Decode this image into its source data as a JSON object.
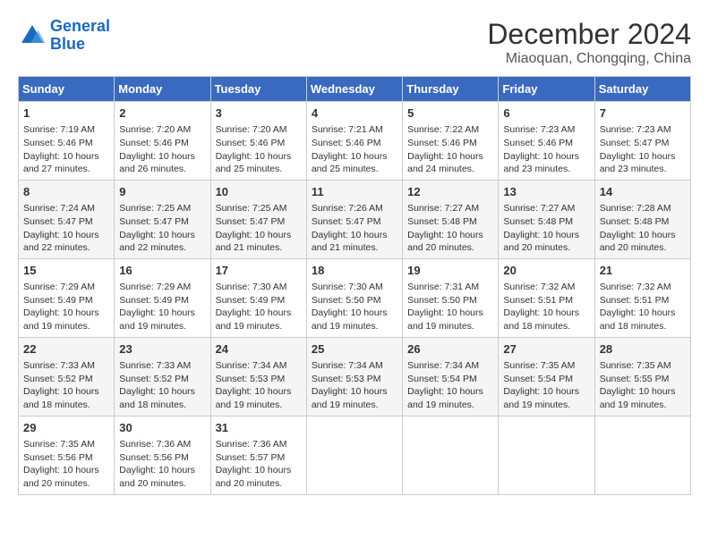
{
  "header": {
    "logo_line1": "General",
    "logo_line2": "Blue",
    "month": "December 2024",
    "location": "Miaoquan, Chongqing, China"
  },
  "weekdays": [
    "Sunday",
    "Monday",
    "Tuesday",
    "Wednesday",
    "Thursday",
    "Friday",
    "Saturday"
  ],
  "weeks": [
    [
      {
        "day": "1",
        "sunrise": "7:19 AM",
        "sunset": "5:46 PM",
        "daylight": "10 hours and 27 minutes."
      },
      {
        "day": "2",
        "sunrise": "7:20 AM",
        "sunset": "5:46 PM",
        "daylight": "10 hours and 26 minutes."
      },
      {
        "day": "3",
        "sunrise": "7:20 AM",
        "sunset": "5:46 PM",
        "daylight": "10 hours and 25 minutes."
      },
      {
        "day": "4",
        "sunrise": "7:21 AM",
        "sunset": "5:46 PM",
        "daylight": "10 hours and 25 minutes."
      },
      {
        "day": "5",
        "sunrise": "7:22 AM",
        "sunset": "5:46 PM",
        "daylight": "10 hours and 24 minutes."
      },
      {
        "day": "6",
        "sunrise": "7:23 AM",
        "sunset": "5:46 PM",
        "daylight": "10 hours and 23 minutes."
      },
      {
        "day": "7",
        "sunrise": "7:23 AM",
        "sunset": "5:47 PM",
        "daylight": "10 hours and 23 minutes."
      }
    ],
    [
      {
        "day": "8",
        "sunrise": "7:24 AM",
        "sunset": "5:47 PM",
        "daylight": "10 hours and 22 minutes."
      },
      {
        "day": "9",
        "sunrise": "7:25 AM",
        "sunset": "5:47 PM",
        "daylight": "10 hours and 22 minutes."
      },
      {
        "day": "10",
        "sunrise": "7:25 AM",
        "sunset": "5:47 PM",
        "daylight": "10 hours and 21 minutes."
      },
      {
        "day": "11",
        "sunrise": "7:26 AM",
        "sunset": "5:47 PM",
        "daylight": "10 hours and 21 minutes."
      },
      {
        "day": "12",
        "sunrise": "7:27 AM",
        "sunset": "5:48 PM",
        "daylight": "10 hours and 20 minutes."
      },
      {
        "day": "13",
        "sunrise": "7:27 AM",
        "sunset": "5:48 PM",
        "daylight": "10 hours and 20 minutes."
      },
      {
        "day": "14",
        "sunrise": "7:28 AM",
        "sunset": "5:48 PM",
        "daylight": "10 hours and 20 minutes."
      }
    ],
    [
      {
        "day": "15",
        "sunrise": "7:29 AM",
        "sunset": "5:49 PM",
        "daylight": "10 hours and 19 minutes."
      },
      {
        "day": "16",
        "sunrise": "7:29 AM",
        "sunset": "5:49 PM",
        "daylight": "10 hours and 19 minutes."
      },
      {
        "day": "17",
        "sunrise": "7:30 AM",
        "sunset": "5:49 PM",
        "daylight": "10 hours and 19 minutes."
      },
      {
        "day": "18",
        "sunrise": "7:30 AM",
        "sunset": "5:50 PM",
        "daylight": "10 hours and 19 minutes."
      },
      {
        "day": "19",
        "sunrise": "7:31 AM",
        "sunset": "5:50 PM",
        "daylight": "10 hours and 19 minutes."
      },
      {
        "day": "20",
        "sunrise": "7:32 AM",
        "sunset": "5:51 PM",
        "daylight": "10 hours and 18 minutes."
      },
      {
        "day": "21",
        "sunrise": "7:32 AM",
        "sunset": "5:51 PM",
        "daylight": "10 hours and 18 minutes."
      }
    ],
    [
      {
        "day": "22",
        "sunrise": "7:33 AM",
        "sunset": "5:52 PM",
        "daylight": "10 hours and 18 minutes."
      },
      {
        "day": "23",
        "sunrise": "7:33 AM",
        "sunset": "5:52 PM",
        "daylight": "10 hours and 18 minutes."
      },
      {
        "day": "24",
        "sunrise": "7:34 AM",
        "sunset": "5:53 PM",
        "daylight": "10 hours and 19 minutes."
      },
      {
        "day": "25",
        "sunrise": "7:34 AM",
        "sunset": "5:53 PM",
        "daylight": "10 hours and 19 minutes."
      },
      {
        "day": "26",
        "sunrise": "7:34 AM",
        "sunset": "5:54 PM",
        "daylight": "10 hours and 19 minutes."
      },
      {
        "day": "27",
        "sunrise": "7:35 AM",
        "sunset": "5:54 PM",
        "daylight": "10 hours and 19 minutes."
      },
      {
        "day": "28",
        "sunrise": "7:35 AM",
        "sunset": "5:55 PM",
        "daylight": "10 hours and 19 minutes."
      }
    ],
    [
      {
        "day": "29",
        "sunrise": "7:35 AM",
        "sunset": "5:56 PM",
        "daylight": "10 hours and 20 minutes."
      },
      {
        "day": "30",
        "sunrise": "7:36 AM",
        "sunset": "5:56 PM",
        "daylight": "10 hours and 20 minutes."
      },
      {
        "day": "31",
        "sunrise": "7:36 AM",
        "sunset": "5:57 PM",
        "daylight": "10 hours and 20 minutes."
      },
      null,
      null,
      null,
      null
    ]
  ]
}
